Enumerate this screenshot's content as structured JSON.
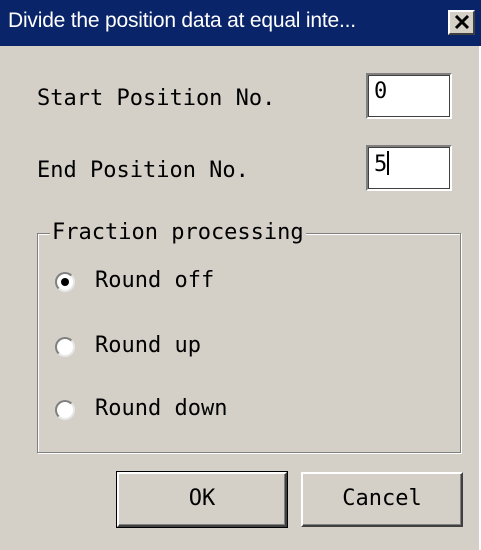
{
  "window": {
    "title": "Divide the position data at equal inte...",
    "close_icon": "close-icon"
  },
  "fields": {
    "start_label": "Start Position No.",
    "start_value": "0",
    "end_label": "End Position No.",
    "end_value": "5"
  },
  "fraction": {
    "legend": "Fraction processing",
    "options": [
      {
        "label": "Round off",
        "selected": true
      },
      {
        "label": "Round up",
        "selected": false
      },
      {
        "label": "Round down",
        "selected": false
      }
    ]
  },
  "buttons": {
    "ok_label": "OK",
    "cancel_label": "Cancel"
  }
}
